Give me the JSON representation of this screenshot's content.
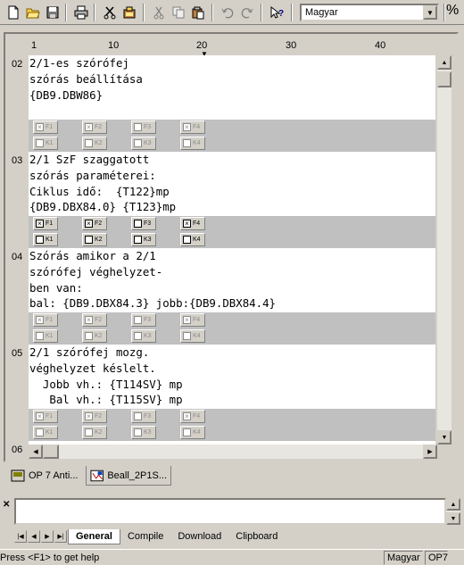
{
  "toolbar": {
    "buttons": [
      "new-file",
      "open-folder",
      "save",
      "print",
      "cut-special",
      "paste-special",
      "cut",
      "copy",
      "paste",
      "undo",
      "redo",
      "context-help"
    ],
    "language": "Magyar",
    "extra": "%"
  },
  "ruler": {
    "labels": [
      "1",
      "10",
      "20",
      "30",
      "40"
    ]
  },
  "editor": {
    "line_numbers": [
      "02",
      "03",
      "04",
      "05",
      "06"
    ],
    "sections": [
      {
        "lines": [
          "2/1-es szórófej",
          "szórás beállítása",
          "{DB9.DBW86}"
        ],
        "fkeys": [
          {
            "label": "F1",
            "checked": true,
            "active": false
          },
          {
            "label": "F2",
            "checked": true,
            "active": false
          },
          {
            "label": "F3",
            "checked": false,
            "active": false
          },
          {
            "label": "F4",
            "checked": true,
            "active": false
          },
          {
            "label": "K1",
            "checked": false,
            "active": false
          },
          {
            "label": "K2",
            "checked": false,
            "active": false
          },
          {
            "label": "K3",
            "checked": false,
            "active": false
          },
          {
            "label": "K4",
            "checked": false,
            "active": false
          }
        ]
      },
      {
        "lines": [
          "2/1 SzF szaggatott",
          "szórás paraméterei:",
          "Ciklus idő:  {T122}mp",
          "{DB9.DBX84.0} {T123}mp"
        ],
        "fkeys": [
          {
            "label": "F1",
            "checked": true,
            "active": true
          },
          {
            "label": "F2",
            "checked": true,
            "active": true
          },
          {
            "label": "F3",
            "checked": false,
            "active": true
          },
          {
            "label": "F4",
            "checked": true,
            "active": true
          },
          {
            "label": "K1",
            "checked": false,
            "active": true
          },
          {
            "label": "K2",
            "checked": false,
            "active": true
          },
          {
            "label": "K3",
            "checked": false,
            "active": true
          },
          {
            "label": "K4",
            "checked": false,
            "active": true
          }
        ]
      },
      {
        "lines": [
          "Szórás amikor a 2/1",
          "szórófej véghelyzet-",
          "ben van:",
          "bal: {DB9.DBX84.3} jobb:{DB9.DBX84.4}"
        ],
        "fkeys": [
          {
            "label": "F1",
            "checked": true,
            "active": false
          },
          {
            "label": "F2",
            "checked": true,
            "active": false
          },
          {
            "label": "F3",
            "checked": false,
            "active": false
          },
          {
            "label": "F4",
            "checked": true,
            "active": false
          },
          {
            "label": "K1",
            "checked": false,
            "active": false
          },
          {
            "label": "K2",
            "checked": false,
            "active": false
          },
          {
            "label": "K3",
            "checked": false,
            "active": false
          },
          {
            "label": "K4",
            "checked": false,
            "active": false
          }
        ]
      },
      {
        "lines": [
          "2/1 szórófej mozg.",
          "véghelyzet késlelt.",
          "  Jobb vh.: {T114SV} mp",
          "   Bal vh.: {T115SV} mp"
        ],
        "fkeys": [
          {
            "label": "F1",
            "checked": true,
            "active": false
          },
          {
            "label": "F2",
            "checked": true,
            "active": false
          },
          {
            "label": "F3",
            "checked": false,
            "active": false
          },
          {
            "label": "F4",
            "checked": true,
            "active": false
          },
          {
            "label": "K1",
            "checked": false,
            "active": false
          },
          {
            "label": "K2",
            "checked": false,
            "active": false
          },
          {
            "label": "K3",
            "checked": false,
            "active": false
          },
          {
            "label": "K4",
            "checked": false,
            "active": false
          }
        ]
      }
    ]
  },
  "doc_tabs": [
    {
      "label": "OP 7 Anti...",
      "active": false,
      "icon": "panel-icon"
    },
    {
      "label": "Beall_2P1S...",
      "active": true,
      "icon": "screen-icon"
    }
  ],
  "output": {
    "tabs": [
      {
        "label": "General",
        "active": true
      },
      {
        "label": "Compile",
        "active": false
      },
      {
        "label": "Download",
        "active": false
      },
      {
        "label": "Clipboard",
        "active": false
      }
    ]
  },
  "status": {
    "text": "Press <F1> to get help",
    "language": "Magyar",
    "device": "OP7"
  }
}
